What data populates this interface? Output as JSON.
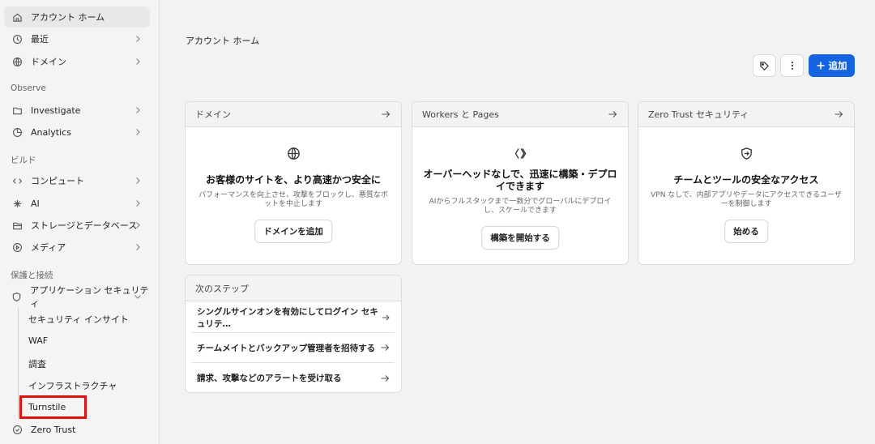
{
  "sidebar": {
    "items": [
      {
        "label": "アカウント ホーム"
      },
      {
        "label": "最近"
      },
      {
        "label": "ドメイン"
      },
      {
        "label": "Investigate"
      },
      {
        "label": "Analytics"
      },
      {
        "label": "コンピュート"
      },
      {
        "label": "AI"
      },
      {
        "label": "ストレージとデータベース"
      },
      {
        "label": "メディア"
      },
      {
        "label": "アプリケーション セキュリティ"
      },
      {
        "label": "Zero Trust"
      }
    ],
    "sections": {
      "observe": "Observe",
      "build": "ビルド",
      "protect": "保護と接続"
    },
    "sub_items": [
      {
        "label": "セキュリティ インサイト"
      },
      {
        "label": "WAF"
      },
      {
        "label": "調査"
      },
      {
        "label": "インフラストラクチャ"
      },
      {
        "label": "Turnstile"
      }
    ]
  },
  "main": {
    "title": "アカウント ホーム",
    "add_label": "追加",
    "cards": [
      {
        "header": "ドメイン",
        "title": "お客様のサイトを、より高速かつ安全に",
        "desc": "パフォーマンスを向上させ、攻撃をブロックし、悪質なボットを中止します",
        "button": "ドメインを追加"
      },
      {
        "header": "Workers と Pages",
        "title": "オーバーヘッドなしで、迅速に構築・デプロイできます",
        "desc": "AIからフルスタックまで一数分でグローバルにデプロイし、スケールできます",
        "button": "構築を開始する"
      },
      {
        "header": "Zero Trust セキュリティ",
        "title": "チームとツールの安全なアクセス",
        "desc": "VPN なしで、内部アプリやデータにアクセスできるユーザーを制御します",
        "button": "始める"
      }
    ],
    "next_steps": {
      "header": "次のステップ",
      "items": [
        {
          "label": "シングルサインオンを有効にしてログイン セキュリテ…"
        },
        {
          "label": "チームメイトとバックアップ管理者を招待する"
        },
        {
          "label": "請求、攻撃などのアラートを受け取る"
        }
      ]
    }
  },
  "colors": {
    "accent": "#1463e0",
    "highlight": "#e01010"
  }
}
